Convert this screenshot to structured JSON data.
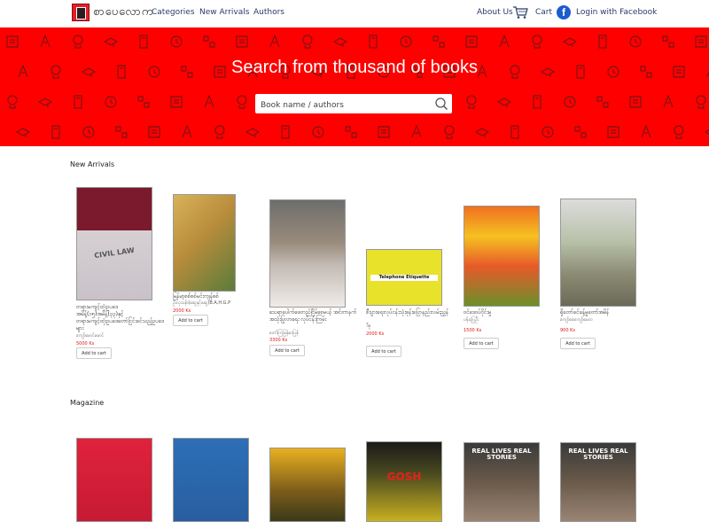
{
  "nav": {
    "logo_text": "စာပေလောက",
    "links": [
      "Categories",
      "New Arrivals",
      "Authors"
    ],
    "about": "About Us",
    "cart": "Cart",
    "login": "Login with Facebook",
    "fb_letter": "f"
  },
  "hero": {
    "title": "Search from thousand of books",
    "search_placeholder": "Book name / authors",
    "background": "#ff0000"
  },
  "sections": {
    "new_arrivals": "New Arrivals",
    "magazine": "Magazine"
  },
  "books": [
    {
      "title": "တရားမကျင့်ထုံးဥပဒေအမိန့်(၁၅)အမိန့်(၃၃)နှင့်တရားမကျင့်ထုံးဥပဒေတော်ငြင်းခင်သည့်ဥပဒေများ",
      "author": "ကျော်မောင်မောင်",
      "price": "5000 Ks",
      "add": "Add to cart",
      "cover_text": "CIVIL LAW"
    },
    {
      "title": "မြန်မာ့စစ်စစ်မင်းကျန်စစ်",
      "author": "ဦးလှသန်း(ဆွေနှင့်ဆွေ)B.A,H.G.P",
      "price": "2000 Ks",
      "add": "Add to cart",
      "cover_text": ""
    },
    {
      "title": "သေရာပေါက်ဖေတည်ငြိမ်စေမယ့် အင်တာနက်အသုံးပြုလာရေး လုပ်ငန်းကြမ်း",
      "author": "တော်ကြမြန်မာပြန်",
      "price": "3300 Ks",
      "add": "Add to cart",
      "cover_text": ""
    },
    {
      "title": "စီးပွားရေးလုပ်ငန်းသုံးဖုန်းပြောနည်းလမ်းညွှန်",
      "author": "ဒီဇူ",
      "price": "2000 Ks",
      "add": "Add to cart",
      "cover_text": "Telephone Etiquette"
    },
    {
      "title": "ဝင်ဒေဝပ်ဝိုင်းမှု",
      "author": "ပန်းပုံပြဦး",
      "price": "1500 Ks",
      "add": "Add to cart",
      "cover_text": ""
    },
    {
      "title": "ရှိတော်ခင်ခန့်မှုတော်အမိန်",
      "author": "ကျော်စေကျော်မေတ",
      "price": "900 Ks",
      "add": "Add to cart",
      "cover_text": ""
    }
  ],
  "magazines": [
    {
      "cover_text": ""
    },
    {
      "cover_text": ""
    },
    {
      "cover_text": ""
    },
    {
      "cover_text": "GOSH"
    },
    {
      "cover_text": "REAL LIVES REAL STORIES"
    },
    {
      "cover_text": "REAL LIVES REAL STORIES"
    }
  ]
}
